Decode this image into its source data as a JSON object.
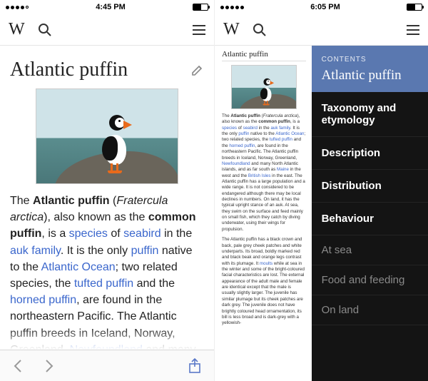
{
  "left": {
    "statusbar": {
      "time": "4:45 PM"
    },
    "article": {
      "title": "Atlantic puffin",
      "lead_html": "The <b>Atlantic puffin</b> (<i>Fratercula arctica</i>), also known as the <b>common puffin</b>, is a <a>species</a> of <a>seabird</a> in the <a>auk</a> <a>family</a>. It is the only <a>puffin</a> native to the <a>Atlantic Ocean</a>; two related species, the <a>tufted puffin</a> and the <a>horned puffin</a>, are found in the northeastern Pacific. The Atlantic puffin breeds in Iceland, Norway, Greenland, <a>Newfoundland</a> and many"
    }
  },
  "right": {
    "statusbar": {
      "time": "6:05 PM"
    },
    "mini": {
      "title": "Atlantic puffin",
      "para1_html": "The <b>Atlantic puffin</b> (<i>Fratercula arctica</i>), also known as the <b>common puffin</b>, is a <a>species</a> of <a>seabird</a> in the <a>auk</a> <a>family</a>. It is the only <a>puffin</a> native to the <a>Atlantic Ocean</a>; two related species, the <a>tufted puffin</a> and the <a>horned puffin</a>, are found in the northeastern Pacific. The Atlantic puffin breeds in Iceland, Norway, Greenland, <a>Newfoundland</a> and many North Atlantic islands, and as far south as <a>Maine</a> in the west and the <a>British Isles</a> in the east. The Atlantic puffin has a large population and a wide range. It is not considered to be endangered although there may be local declines in numbers. On land, it has the typical upright stance of an auk. At sea, they swim on the surface and feed mainly on small fish, which they catch by diving underwater, using their wings for propulsion.",
      "para2_html": "The Atlantic puffin has a black crown and back, pale grey cheek patches and white underparts. Its broad, boldly marked red and black beak and orange legs contrast with its plumage. It <a>moults</a> while at sea in the winter and some of the bright-coloured facial characteristics are lost. The external appearance of the adult male and female are identical except that the male is usually slightly larger. The juvenile has similar plumage but its cheek patches are dark grey. The juvenile does not have brightly coloured head ornamentation, its bill is less broad and is dark-grey with a yellowish-"
    },
    "drawer": {
      "label": "CONTENTS",
      "title": "Atlantic puffin",
      "items": [
        {
          "label": "Taxonomy and etymology",
          "sub": false
        },
        {
          "label": "Description",
          "sub": false
        },
        {
          "label": "Distribution",
          "sub": false
        },
        {
          "label": "Behaviour",
          "sub": false
        },
        {
          "label": "At sea",
          "sub": true
        },
        {
          "label": "Food and feeding",
          "sub": true
        },
        {
          "label": "On land",
          "sub": true
        }
      ]
    }
  }
}
